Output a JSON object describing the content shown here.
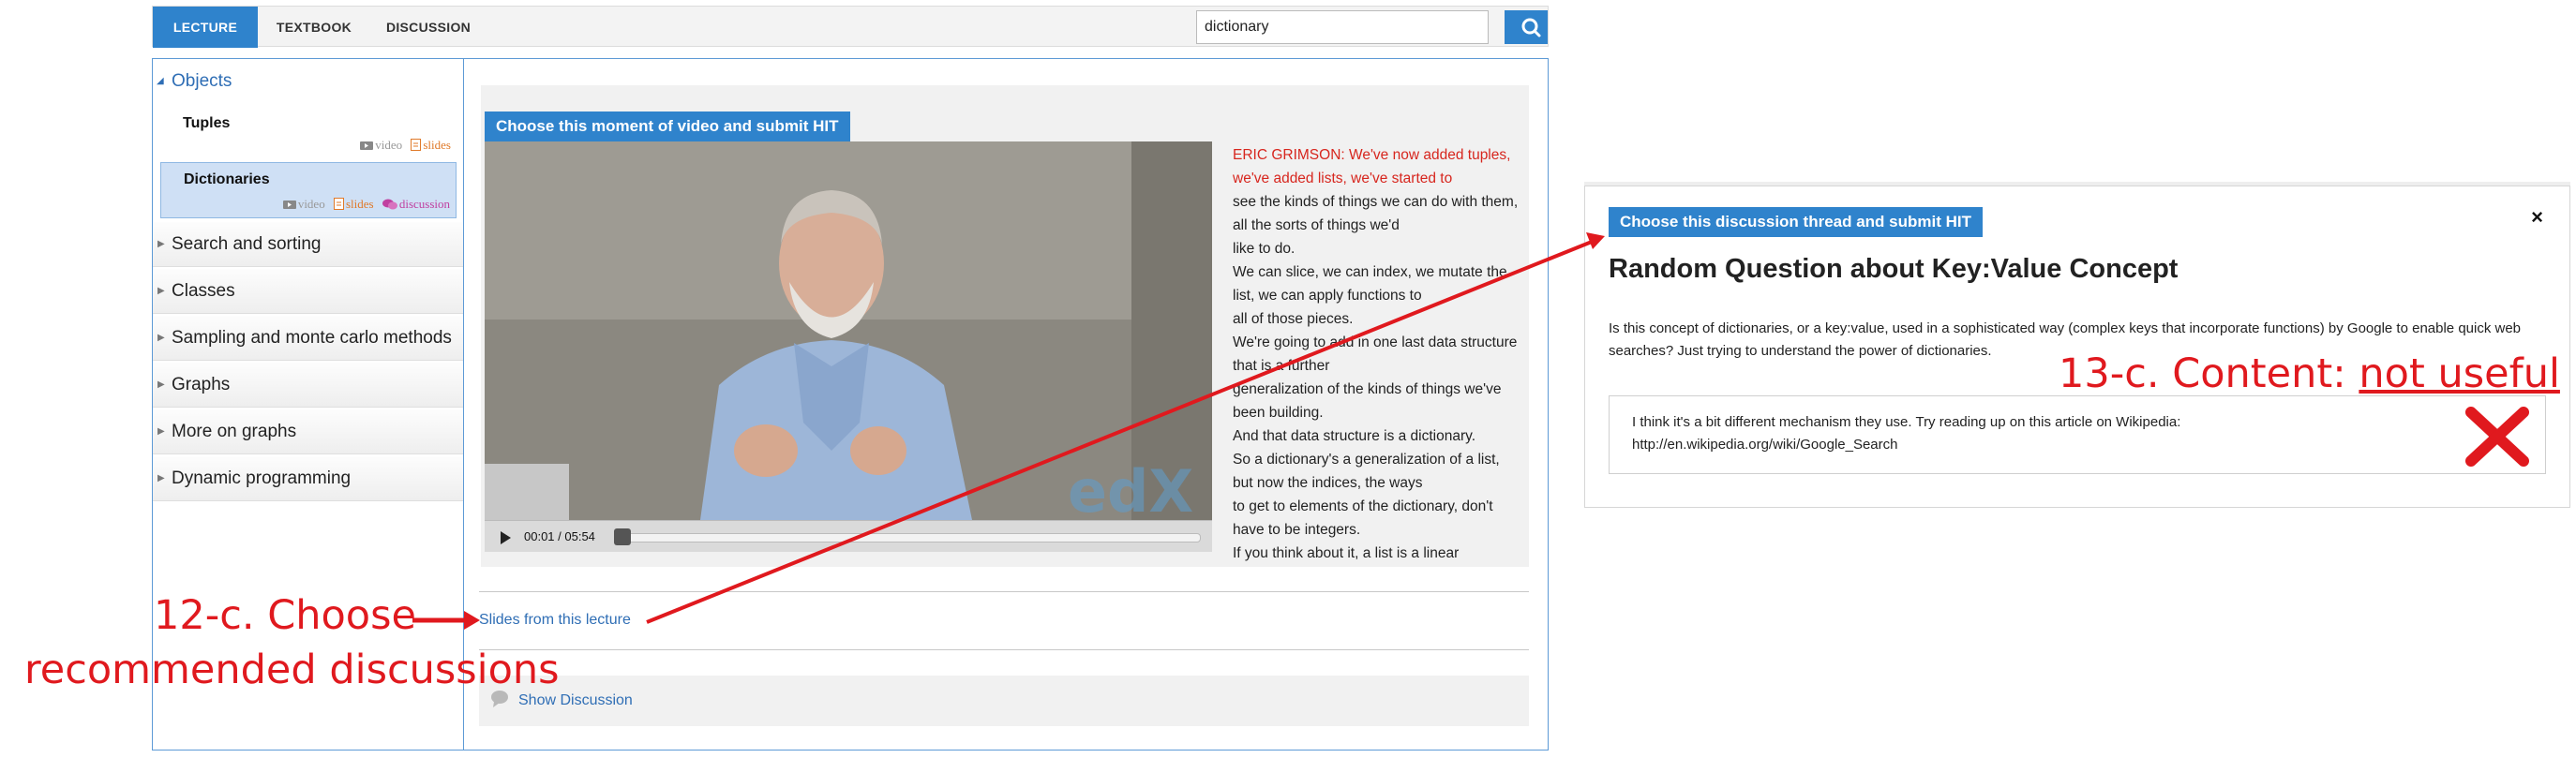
{
  "tabs": [
    {
      "label": "LECTURE",
      "active": true
    },
    {
      "label": "TEXTBOOK",
      "active": false
    },
    {
      "label": "DISCUSSION",
      "active": false
    }
  ],
  "search": {
    "value": "dictionary",
    "icon": "search-icon"
  },
  "sidebar": {
    "objects_label": "Objects",
    "items": [
      {
        "title": "Tuples",
        "video": "video",
        "slides": "slides"
      },
      {
        "title": "Dictionaries",
        "video": "video",
        "slides": "slides",
        "discussion": "discussion"
      }
    ],
    "sections": [
      "Search and sorting",
      "Classes",
      "Sampling and monte carlo methods",
      "Graphs",
      "More on graphs",
      "Dynamic programming"
    ]
  },
  "video_panel": {
    "hit_label": "Choose this moment of video and submit HIT",
    "time": "00:01 / 05:54",
    "watermark": "edX",
    "transcript_highlight": "ERIC GRIMSON: We've now added tuples, we've added lists, we've started to",
    "transcript": [
      "see the kinds of things we can do with them, all the sorts of things we'd",
      "like to do.",
      "We can slice, we can index, we mutate the list, we can apply functions to",
      "all of those pieces.",
      "We're going to add in one last data structure that is a further",
      "generalization of the kinds of things we've been building.",
      "And that data structure is a dictionary.",
      "So a dictionary's a generalization of a list, but now the indices, the ways",
      "to get to elements of the dictionary, don't have to be integers.",
      "If you think about it, a list is a linear"
    ]
  },
  "slides_link": "Slides from this lecture",
  "show_discussion": "Show Discussion",
  "discussion": {
    "hit_label": "Choose this discussion thread and submit HIT",
    "close": "×",
    "title": "Random Question about Key:Value Concept",
    "body": "Is this concept of dictionaries, or a key:value, used in a sophisticated way (complex keys that incorporate functions) by Google to enable quick web searches? Just trying to understand the power of dictionaries.",
    "reply_line1": "I think it's a bit different mechanism they use. Try reading up on this article on Wikipedia:",
    "reply_line2": "http://en.wikipedia.org/wiki/Google_Search"
  },
  "annotations": {
    "step12_line1": "12-c. Choose",
    "step12_line2": "recommended discussions",
    "step13_prefix": "13-c. Content: ",
    "step13_value": "not useful",
    "color": "#e0191e"
  },
  "colors": {
    "accent": "#2f83cc",
    "link": "#2f6eb5",
    "annotation": "#e0191e"
  }
}
